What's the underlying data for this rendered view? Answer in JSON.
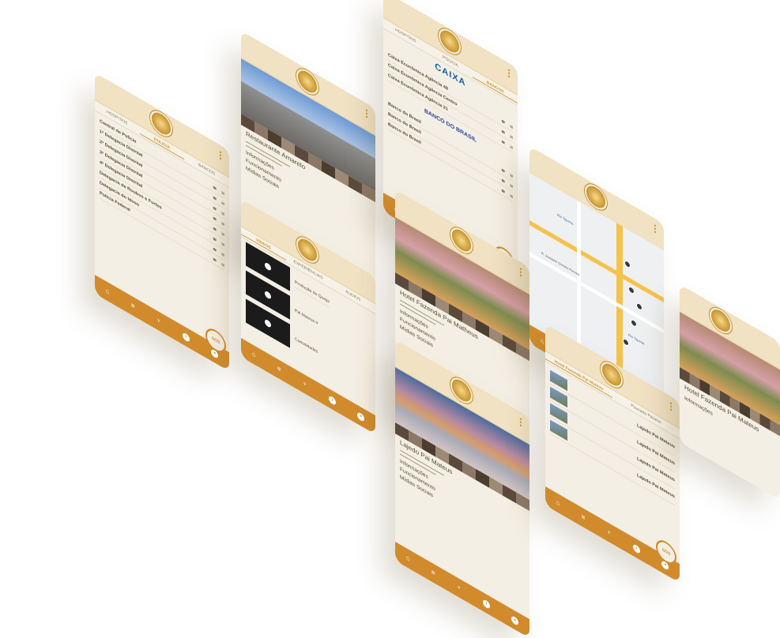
{
  "footer": [
    "",
    "",
    "",
    "",
    ""
  ],
  "fab_label": "",
  "screen1": {
    "tabs": [
      "HOSPITAIS",
      "POLÍCIA",
      "BANCOS"
    ],
    "rows": [
      {
        "t": "Central de Polícia",
        "s": ""
      },
      {
        "t": "1ª Delegacia Distrital",
        "s": ""
      },
      {
        "t": "2ª Delegacia Distrital",
        "s": ""
      },
      {
        "t": "3ª Delegacia Distrital",
        "s": ""
      },
      {
        "t": "4ª Delegacia Distrital",
        "s": ""
      },
      {
        "t": "Delegacia de Roubos e Furtos",
        "s": ""
      },
      {
        "t": "Delegacia do Idoso",
        "s": ""
      },
      {
        "t": "Polícia Federal",
        "s": ""
      }
    ]
  },
  "screen2": {
    "title": "Restaurante Amarelo",
    "sections": [
      "Informações",
      "Funcionamento",
      "Mídias Sociais"
    ]
  },
  "screen3": {
    "tabs": [
      "HOSPITAIS",
      "POLÍCIA",
      "BANCOS"
    ],
    "brand1": "CAIXA",
    "rows1": [
      {
        "t": "Caixa Econômica Agência 48",
        "s": ""
      },
      {
        "t": "Caixa Econômica Agência Centro",
        "s": ""
      },
      {
        "t": "Caixa Econômica Agência 21",
        "s": ""
      }
    ],
    "brand2": "BANCO DO BRASIL",
    "rows2": [
      {
        "t": "Banco do Brasil",
        "s": ""
      },
      {
        "t": "Banco do Brasil",
        "s": ""
      },
      {
        "t": "Banco do Brasil",
        "s": ""
      }
    ]
  },
  "screen4": {
    "tabs": [
      "VÍDEOS",
      "EXPERIÊNCIAS",
      "ÁUDIOS"
    ],
    "items": [
      "Produção do Queijo",
      "Pai Mateus II",
      "Curiosidades"
    ]
  },
  "screen5": {
    "title": "Hotel Fazenda Pai Matheus",
    "sections": [
      "Informações",
      "Funcionamento",
      "Mídias Sociais"
    ]
  },
  "screen6": {
    "labels": [
      "Rio Tapeoa",
      "R. Joaquim Gomes Pereira",
      "Rio Tapeoa"
    ]
  },
  "screen7": {
    "title": "Lajedo Pai Mateus",
    "sections": [
      "Informações",
      "Funcionamento",
      "Mídias Sociais"
    ]
  },
  "screen8": {
    "tabs": [
      "Hotel Fazenda Pai Mateus",
      "Pousada Paraíso"
    ],
    "items": [
      "Lajedo Pai Mateus",
      "Lajedo Pai Mateus",
      "Lajedo Pai Mateus",
      "Lajedo Pai Mateus"
    ]
  },
  "screen9": {
    "title": "Hotel Fazenda Pai Mateus",
    "sections": [
      "Informações"
    ]
  }
}
